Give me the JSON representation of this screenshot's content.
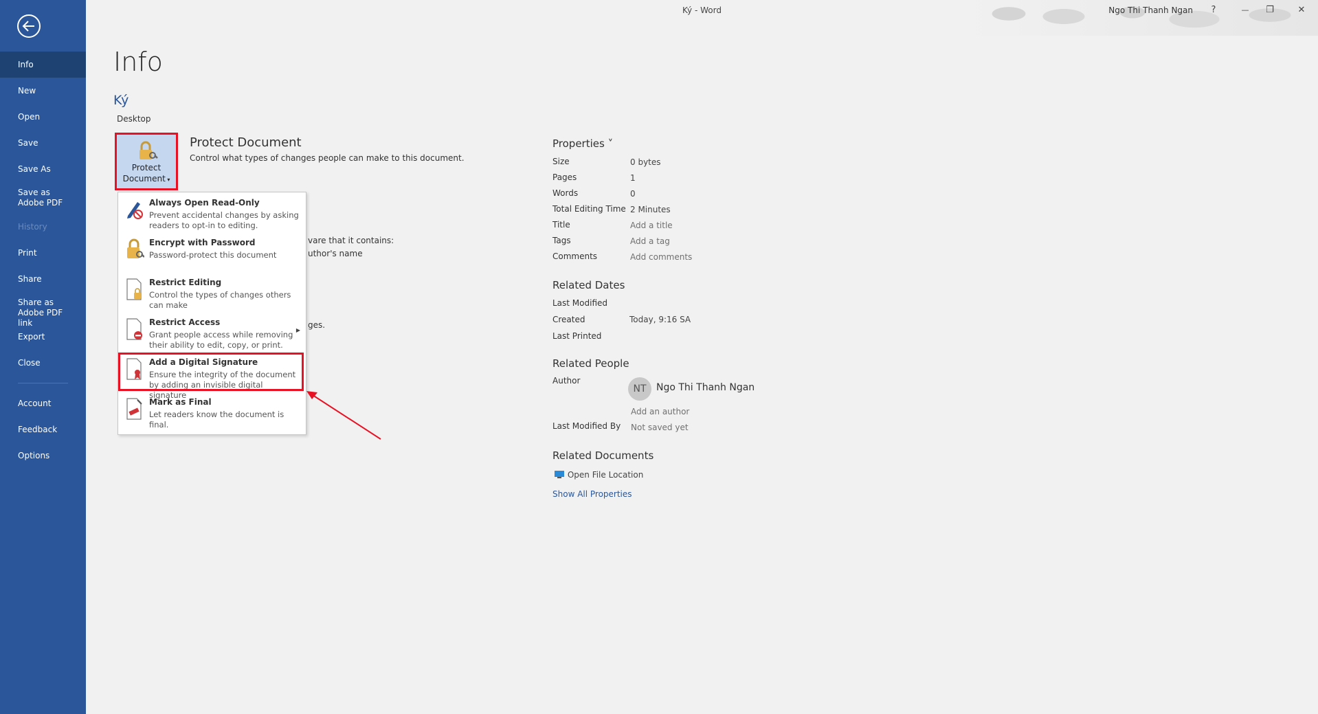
{
  "window": {
    "title": "Ký  -  Word",
    "user": "Ngo Thi Thanh Ngan",
    "help": "?",
    "minimize": "—",
    "restore": "❐",
    "close": "✕"
  },
  "sidebar": {
    "items": [
      {
        "label": "Info"
      },
      {
        "label": "New"
      },
      {
        "label": "Open"
      },
      {
        "label": "Save"
      },
      {
        "label": "Save As"
      },
      {
        "label": "Save as Adobe PDF"
      },
      {
        "label": "History"
      },
      {
        "label": "Print"
      },
      {
        "label": "Share"
      },
      {
        "label": "Share as Adobe PDF link"
      },
      {
        "label": "Export"
      },
      {
        "label": "Close"
      },
      {
        "label": "Account"
      },
      {
        "label": "Feedback"
      },
      {
        "label": "Options"
      }
    ]
  },
  "main": {
    "title": "Info",
    "doc_name": "Ký",
    "location": "Desktop",
    "protect": {
      "button_label_line1": "Protect",
      "button_label_line2": "Document",
      "title": "Protect Document",
      "description": "Control what types of changes people can make to this document."
    },
    "behind": {
      "line1": "vare that it contains:",
      "line2": "uthor's name",
      "line3": "ges."
    }
  },
  "menu": {
    "items": [
      {
        "title": "Always Open Read-Only",
        "desc": "Prevent accidental changes by asking readers to opt-in to editing."
      },
      {
        "title": "Encrypt with Password",
        "desc": "Password-protect this document"
      },
      {
        "title": "Restrict Editing",
        "desc": "Control the types of changes others can make"
      },
      {
        "title": "Restrict Access",
        "desc": "Grant people access while removing their ability to edit, copy, or print."
      },
      {
        "title": "Add a Digital Signature",
        "desc": "Ensure the integrity of the document by adding an invisible digital signature"
      },
      {
        "title": "Mark as Final",
        "desc": "Let readers know the document is final."
      }
    ]
  },
  "properties": {
    "header": "Properties ˅",
    "rows": [
      {
        "key": "Size",
        "value": "0 bytes"
      },
      {
        "key": "Pages",
        "value": "1"
      },
      {
        "key": "Words",
        "value": "0"
      },
      {
        "key": "Total Editing Time",
        "value": "2 Minutes"
      },
      {
        "key": "Title",
        "value": "Add a title"
      },
      {
        "key": "Tags",
        "value": "Add a tag"
      },
      {
        "key": "Comments",
        "value": "Add comments"
      }
    ],
    "related_dates": {
      "header": "Related Dates",
      "last_modified": "Last Modified",
      "created": "Created",
      "created_value": "Today, 9:16 SA",
      "last_printed": "Last Printed"
    },
    "related_people": {
      "header": "Related People",
      "author": "Author",
      "author_initials": "NT",
      "author_name": "Ngo Thi Thanh Ngan",
      "add_author": "Add an author",
      "last_modified_by": "Last Modified By",
      "not_saved": "Not saved yet"
    },
    "related_documents": {
      "header": "Related Documents",
      "open_location": "Open File Location",
      "show_all": "Show All Properties"
    }
  }
}
